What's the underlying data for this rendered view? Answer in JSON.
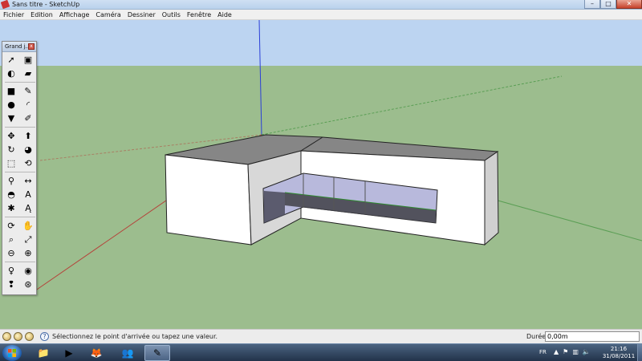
{
  "window": {
    "title": "Sans titre - SketchUp",
    "minimize": "–",
    "maximize": "□",
    "close": "✕"
  },
  "menu": [
    "Fichier",
    "Edition",
    "Affichage",
    "Caméra",
    "Dessiner",
    "Outils",
    "Fenêtre",
    "Aide"
  ],
  "palette": {
    "title": "Grand j...",
    "close": "x",
    "tools": [
      {
        "name": "select-tool-icon",
        "glyph": "➚"
      },
      {
        "name": "make-component-tool-icon",
        "glyph": "▣"
      },
      {
        "name": "paint-bucket-tool-icon",
        "glyph": "◐"
      },
      {
        "name": "eraser-tool-icon",
        "glyph": "▰"
      },
      {
        "name": "rectangle-tool-icon",
        "glyph": "■"
      },
      {
        "name": "line-tool-icon",
        "glyph": "✎"
      },
      {
        "name": "circle-tool-icon",
        "glyph": "●"
      },
      {
        "name": "arc-tool-icon",
        "glyph": "◜"
      },
      {
        "name": "polygon-tool-icon",
        "glyph": "▼"
      },
      {
        "name": "freehand-tool-icon",
        "glyph": "✐"
      },
      {
        "name": "move-tool-icon",
        "glyph": "✥"
      },
      {
        "name": "push-pull-tool-icon",
        "glyph": "⬆"
      },
      {
        "name": "rotate-tool-icon",
        "glyph": "↻"
      },
      {
        "name": "follow-me-tool-icon",
        "glyph": "◕"
      },
      {
        "name": "scale-tool-icon",
        "glyph": "⬚"
      },
      {
        "name": "offset-tool-icon",
        "glyph": "⟲"
      },
      {
        "name": "tape-measure-tool-icon",
        "glyph": "⚲"
      },
      {
        "name": "dimension-tool-icon",
        "glyph": "↔"
      },
      {
        "name": "protractor-tool-icon",
        "glyph": "◓"
      },
      {
        "name": "text-tool-icon",
        "glyph": "A"
      },
      {
        "name": "axes-tool-icon",
        "glyph": "✱"
      },
      {
        "name": "3d-text-tool-icon",
        "glyph": "Ą"
      },
      {
        "name": "orbit-tool-icon",
        "glyph": "⟳"
      },
      {
        "name": "pan-tool-icon",
        "glyph": "✋"
      },
      {
        "name": "zoom-tool-icon",
        "glyph": "⌕"
      },
      {
        "name": "zoom-extents-tool-icon",
        "glyph": "⤢"
      },
      {
        "name": "previous-view-icon",
        "glyph": "⊖"
      },
      {
        "name": "next-view-icon",
        "glyph": "⊕"
      },
      {
        "name": "position-camera-tool-icon",
        "glyph": "♀"
      },
      {
        "name": "look-around-tool-icon",
        "glyph": "◉"
      },
      {
        "name": "walk-tool-icon",
        "glyph": "❢"
      },
      {
        "name": "section-plane-tool-icon",
        "glyph": "⊛"
      }
    ]
  },
  "status": {
    "message": "Sélectionnez le point d'arrivée ou tapez une valeur.",
    "help": "?",
    "measure_label": "Durée",
    "measure_value": "0,00m"
  },
  "taskbar": {
    "lang": "FR",
    "time": "21:16",
    "date": "31/08/2011",
    "tasks": [
      {
        "name": "explorer-task-icon",
        "glyph": "📁"
      },
      {
        "name": "media-player-task-icon",
        "glyph": "▶"
      },
      {
        "name": "firefox-task-icon",
        "glyph": "🦊"
      },
      {
        "name": "messenger-task-icon",
        "glyph": "👥"
      },
      {
        "name": "sketchup-task-icon",
        "glyph": "✎"
      }
    ]
  },
  "colors": {
    "sky": "#bcd4f1",
    "ground": "#9cbd8e",
    "wall": "#ffffff",
    "roof": "#868686",
    "side": "#d4d4d4",
    "glass": "#b8b9dc"
  }
}
